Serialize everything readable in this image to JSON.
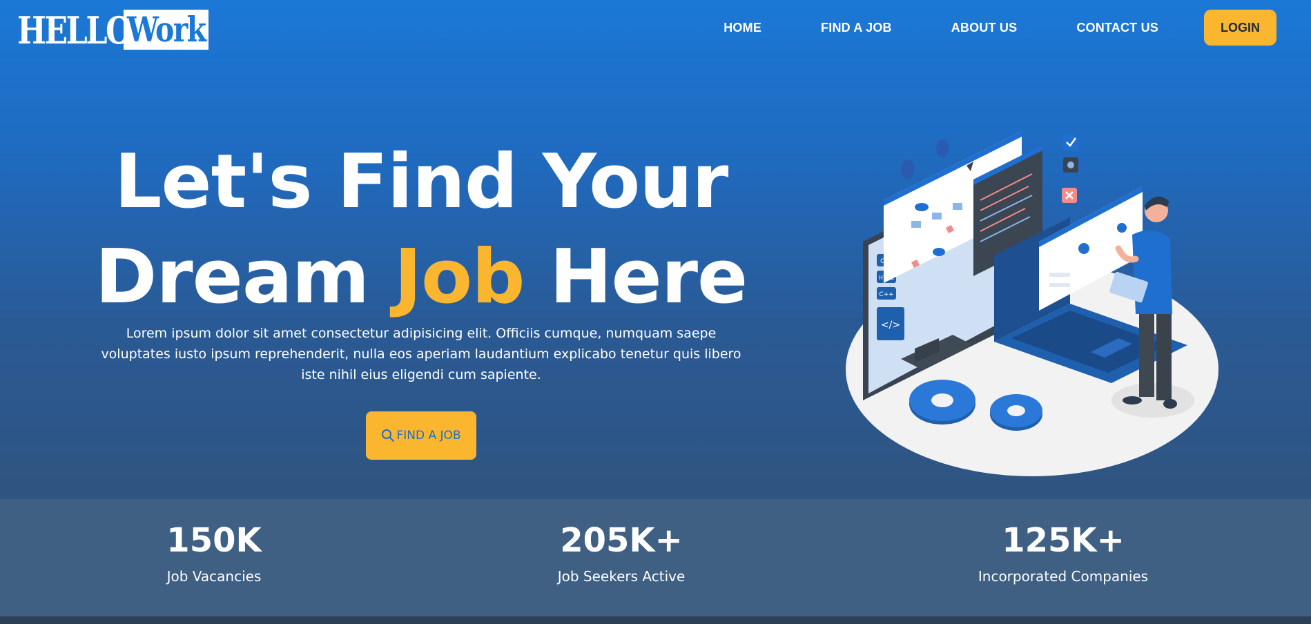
{
  "logo": {
    "part1": "HELLO!",
    "part2": "Work"
  },
  "nav": {
    "home": "HOME",
    "find_job": "FIND A JOB",
    "about": "ABOUT US",
    "contact": "CONTACT US",
    "login": "LOGIN"
  },
  "hero": {
    "line1": "Let's Find Your",
    "line2_start": "Dream ",
    "line2_accent": "Job",
    "line2_end": " Here",
    "description": "Lorem ipsum dolor sit amet consectetur adipisicing elit. Officiis cumque, numquam saepe voluptates iusto ipsum reprehenderit, nulla eos aperiam laudantium explicabo tenetur quis libero iste nihil eius eligendi cum sapiente.",
    "cta_label": "FIND A JOB",
    "cta_icon": "search-icon"
  },
  "illustration": {
    "tags": [
      "CSS",
      "HTML",
      "C++"
    ],
    "code_symbol": "</>"
  },
  "stats": [
    {
      "value": "150K",
      "label": "Job Vacancies"
    },
    {
      "value": "205K+",
      "label": "Job Seekers Active"
    },
    {
      "value": "125K+",
      "label": "Incorporated Companies"
    }
  ],
  "colors": {
    "primary": "#1b78d6",
    "accent": "#fbb630",
    "stats_bg": "#3f6083"
  }
}
